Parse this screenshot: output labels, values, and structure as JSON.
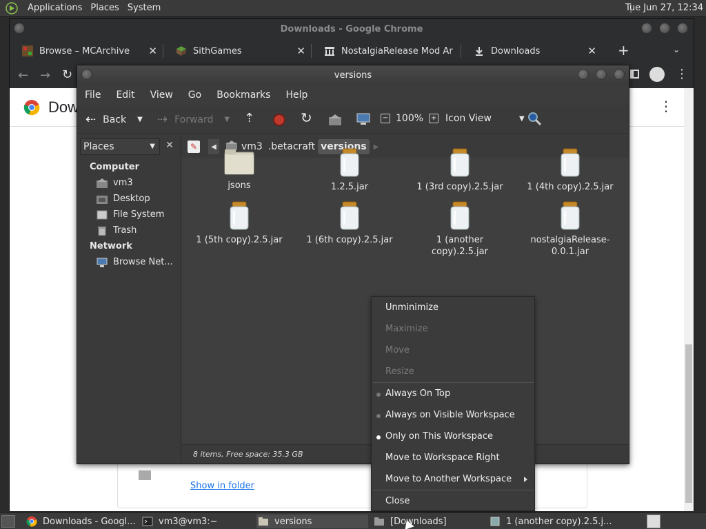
{
  "top_panel": {
    "menus": [
      "Applications",
      "Places",
      "System"
    ],
    "clock": "Tue Jun 27, 12:34"
  },
  "chrome": {
    "title": "Downloads - Google Chrome",
    "tabs": [
      {
        "label": "Browse – MCArchive"
      },
      {
        "label": "SithGames"
      },
      {
        "label": "NostalgiaRelease Mod Ar"
      },
      {
        "label": "Downloads"
      }
    ],
    "page_title": "Dow",
    "show_in_folder": "Show in folder"
  },
  "file_manager": {
    "title": "versions",
    "menus": [
      "File",
      "Edit",
      "View",
      "Go",
      "Bookmarks",
      "Help"
    ],
    "toolbar": {
      "back": "Back",
      "forward": "Forward",
      "zoom": "100%",
      "view_mode": "Icon View"
    },
    "sidebar": {
      "combo": "Places",
      "sections": [
        {
          "heading": "Computer",
          "items": [
            "vm3",
            "Desktop",
            "File System",
            "Trash"
          ]
        },
        {
          "heading": "Network",
          "items": [
            "Browse Net..."
          ]
        }
      ]
    },
    "path": [
      "vm3",
      ".betacraft",
      "versions"
    ],
    "files": [
      {
        "name": "jsons",
        "type": "folder"
      },
      {
        "name": "1.2.5.jar",
        "type": "jar"
      },
      {
        "name": "1 (3rd copy).2.5.jar",
        "type": "jar"
      },
      {
        "name": "1 (4th copy).2.5.jar",
        "type": "jar"
      },
      {
        "name": "1 (5th copy).2.5.jar",
        "type": "jar"
      },
      {
        "name": "1 (6th copy).2.5.jar",
        "type": "jar"
      },
      {
        "name": "1 (another copy).2.5.jar",
        "type": "jar"
      },
      {
        "name": "nostalgiaRelease-0.0.1.jar",
        "type": "jar"
      }
    ],
    "status": "8 items, Free space: 35.3 GB"
  },
  "context_menu": {
    "items": [
      {
        "label": "Unminimize",
        "enabled": true
      },
      {
        "label": "Maximize",
        "enabled": false
      },
      {
        "label": "Move",
        "enabled": false
      },
      {
        "label": "Resize",
        "enabled": false
      },
      {
        "label": "Always On Top",
        "enabled": true,
        "radio": false
      },
      {
        "label": "Always on Visible Workspace",
        "enabled": true,
        "radio": false
      },
      {
        "label": "Only on This Workspace",
        "enabled": true,
        "radio": true
      },
      {
        "label": "Move to Workspace Right",
        "enabled": true
      },
      {
        "label": "Move to Another Workspace",
        "enabled": true,
        "submenu": true
      },
      {
        "label": "Close",
        "enabled": true
      }
    ]
  },
  "taskbar": {
    "items": [
      {
        "label": "Downloads - Googl..."
      },
      {
        "label": "vm3@vm3:~"
      },
      {
        "label": "versions"
      },
      {
        "label": "[Downloads]"
      },
      {
        "label": "1 (another copy).2.5.j..."
      }
    ]
  }
}
